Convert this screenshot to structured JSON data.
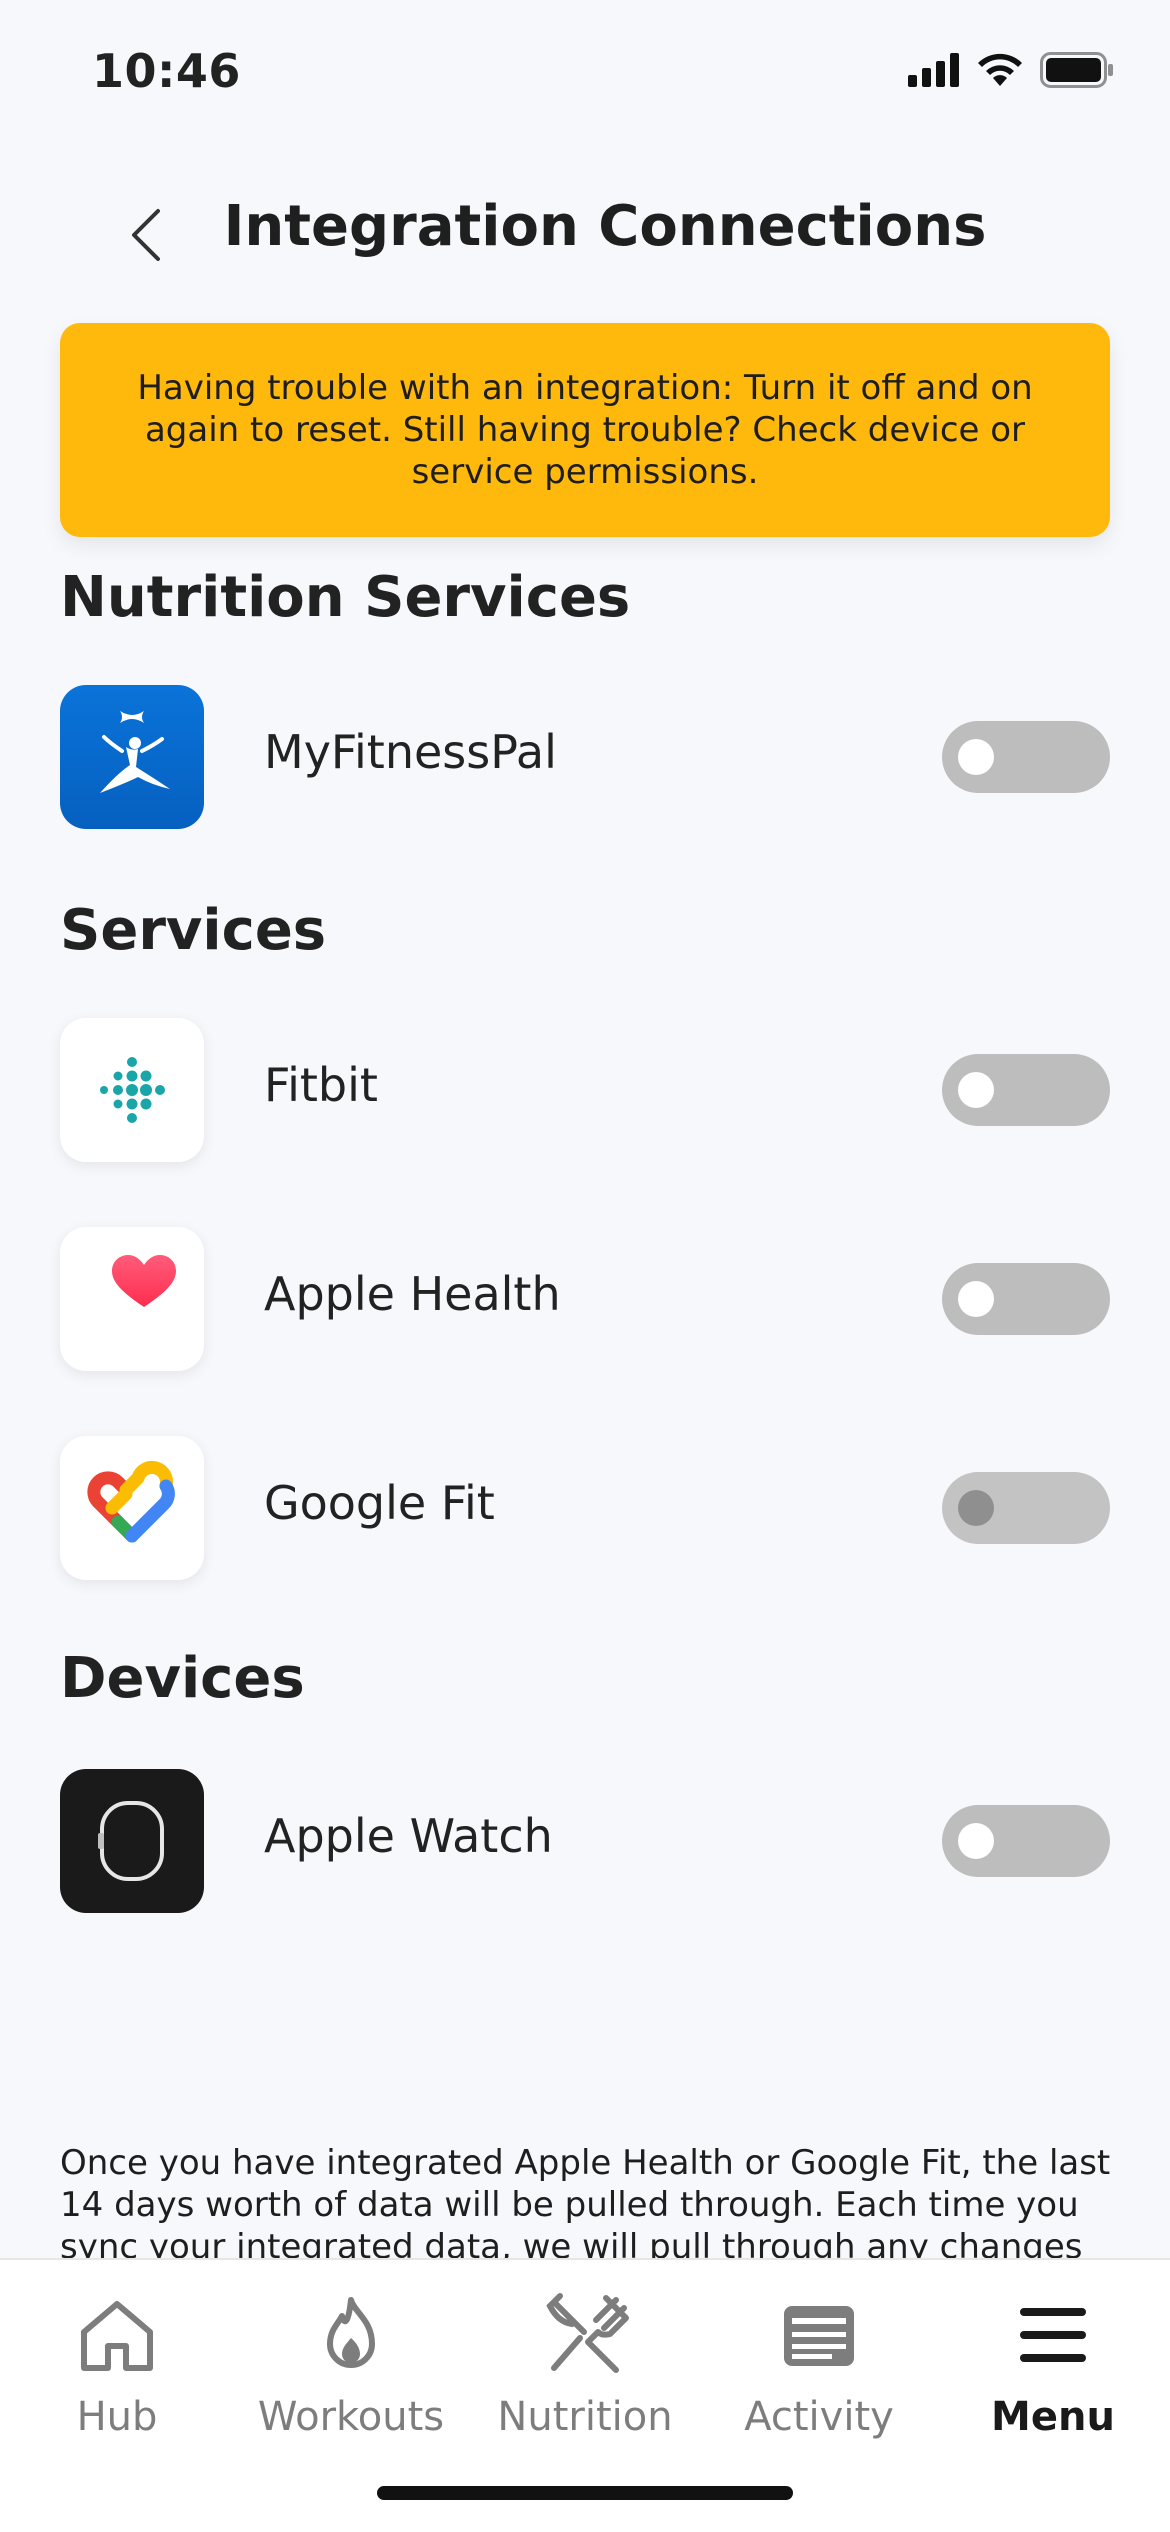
{
  "status": {
    "time": "10:46"
  },
  "header": {
    "title": "Integration Connections"
  },
  "banner": {
    "text": "Having trouble with an integration: Turn it off and on again to reset. Still having trouble? Check device or service permissions."
  },
  "sections": {
    "nutrition": {
      "title": "Nutrition Services",
      "items": [
        {
          "label": "MyFitnessPal",
          "enabled": false
        }
      ]
    },
    "services": {
      "title": "Services",
      "items": [
        {
          "label": "Fitbit",
          "enabled": false
        },
        {
          "label": "Apple Health",
          "enabled": false
        },
        {
          "label": "Google Fit",
          "enabled": false
        }
      ]
    },
    "devices": {
      "title": "Devices",
      "items": [
        {
          "label": "Apple Watch",
          "enabled": false
        }
      ]
    }
  },
  "footer": {
    "text": "Once you have integrated Apple Health or Google Fit, the last 14 days worth of data will be pulled through. Each time you sync your integrated data, we will pull through any changes"
  },
  "tabs": [
    {
      "label": "Hub",
      "icon": "home-icon"
    },
    {
      "label": "Workouts",
      "icon": "flame-icon"
    },
    {
      "label": "Nutrition",
      "icon": "utensils-icon"
    },
    {
      "label": "Activity",
      "icon": "news-icon"
    },
    {
      "label": "Menu",
      "icon": "menu-icon",
      "active": true
    }
  ],
  "colors": {
    "banner": "#ffb80c",
    "toggle_off": "#bdbdbd",
    "background": "#f7f8fc"
  }
}
